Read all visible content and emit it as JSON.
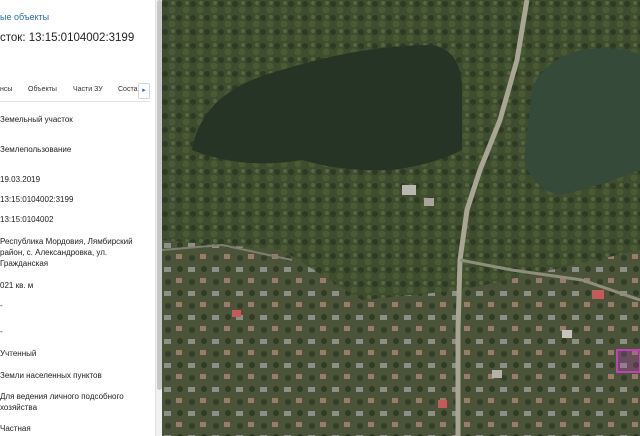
{
  "panel": {
    "back_link": "ые объекты",
    "title": "сток: 13:15:0104002:3199",
    "tabs": [
      {
        "label": "нсы"
      },
      {
        "label": "Объекты"
      },
      {
        "label": "Части ЗУ"
      },
      {
        "label": "Соста"
      }
    ],
    "tab_scroll_glyph": "▸",
    "fields": [
      {
        "value": "Земельный участок"
      },
      {
        "value": "Землепользование"
      },
      {
        "value": "19.03.2019"
      },
      {
        "value": "13:15:0104002:3199"
      },
      {
        "value": "13:15:0104002"
      },
      {
        "value": "Республика Мордовия, Лямбирский район, с. Александровка, ул. Гражданская"
      },
      {
        "value": "021 кв. м"
      },
      {
        "value": "-"
      },
      {
        "value": "-"
      },
      {
        "value": "Учтенный"
      },
      {
        "value": "Земли населенных пунктов"
      },
      {
        "value": "Для ведения личного подсобного хозяйства"
      },
      {
        "value": "Частная"
      }
    ]
  },
  "colors": {
    "link": "#2a6db4",
    "parcel_outline": "#c040c0",
    "water": "#263425",
    "vegetation": "#3a4a2c"
  },
  "map": {
    "layer": "satellite"
  }
}
